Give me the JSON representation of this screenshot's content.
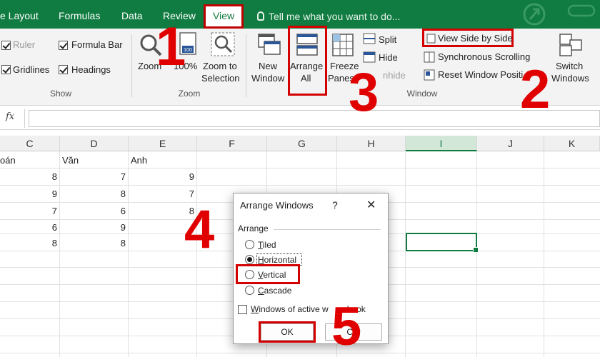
{
  "tabs": [
    {
      "label": "e Layout"
    },
    {
      "label": "Formulas"
    },
    {
      "label": "Data"
    },
    {
      "label": "Review"
    },
    {
      "label": "View"
    }
  ],
  "tell_me": "Tell me what you want to do...",
  "show_group": {
    "label": "Show",
    "ruler": "Ruler",
    "formula_bar": "Formula Bar",
    "gridlines": "Gridlines",
    "headings": "Headings"
  },
  "zoom_group": {
    "label": "Zoom",
    "zoom": "Zoom",
    "hundred": "100%",
    "zoom_to_line1": "Zoom to",
    "zoom_to_line2": "Selection",
    "icon_badge": "100"
  },
  "window_group": {
    "label": "Window",
    "new_window_line1": "New",
    "new_window_line2": "Window",
    "arrange_line1": "Arrange",
    "arrange_line2": "All",
    "freeze_line1": "Freeze",
    "freeze_line2": "Panes",
    "split": "Split",
    "hide": "Hide",
    "unhide": "nhide",
    "view_side_by_side": "View Side by Side",
    "sync_scrolling": "Synchronous Scrolling",
    "reset_position": "Reset Window Positi",
    "switch_line1": "Switch",
    "switch_line2": "Windows"
  },
  "formula_bar": {
    "fx": "fx"
  },
  "columns": [
    "C",
    "D",
    "E",
    "F",
    "G",
    "H",
    "I",
    "J",
    "K"
  ],
  "selected_column": "I",
  "header_row": [
    "oán",
    "Văn",
    "Anh"
  ],
  "rows": [
    {
      "c": "8",
      "d": "7",
      "e": "9"
    },
    {
      "c": "9",
      "d": "8",
      "e": "7"
    },
    {
      "c": "7",
      "d": "6",
      "e": "8"
    },
    {
      "c": "6",
      "d": "9",
      "e": ""
    },
    {
      "c": "8",
      "d": "8",
      "e": ""
    }
  ],
  "dialog": {
    "title": "Arrange Windows",
    "help": "?",
    "close": "✕",
    "group": "Arrange",
    "options": [
      {
        "key": "T",
        "rest": "iled",
        "selected": false
      },
      {
        "key": "H",
        "rest": "orizontal",
        "selected": true
      },
      {
        "key": "V",
        "rest": "ertical",
        "selected": false
      },
      {
        "key": "C",
        "rest": "ascade",
        "selected": false
      }
    ],
    "checkbox_key": "W",
    "checkbox_rest": "indows of active w",
    "checkbox_tail": "book",
    "ok": "OK",
    "cancel": "Car"
  },
  "annotations": [
    "1",
    "2",
    "3",
    "4",
    "5"
  ],
  "colors": {
    "excel_green": "#107c41",
    "annotation_red": "#e00000"
  }
}
